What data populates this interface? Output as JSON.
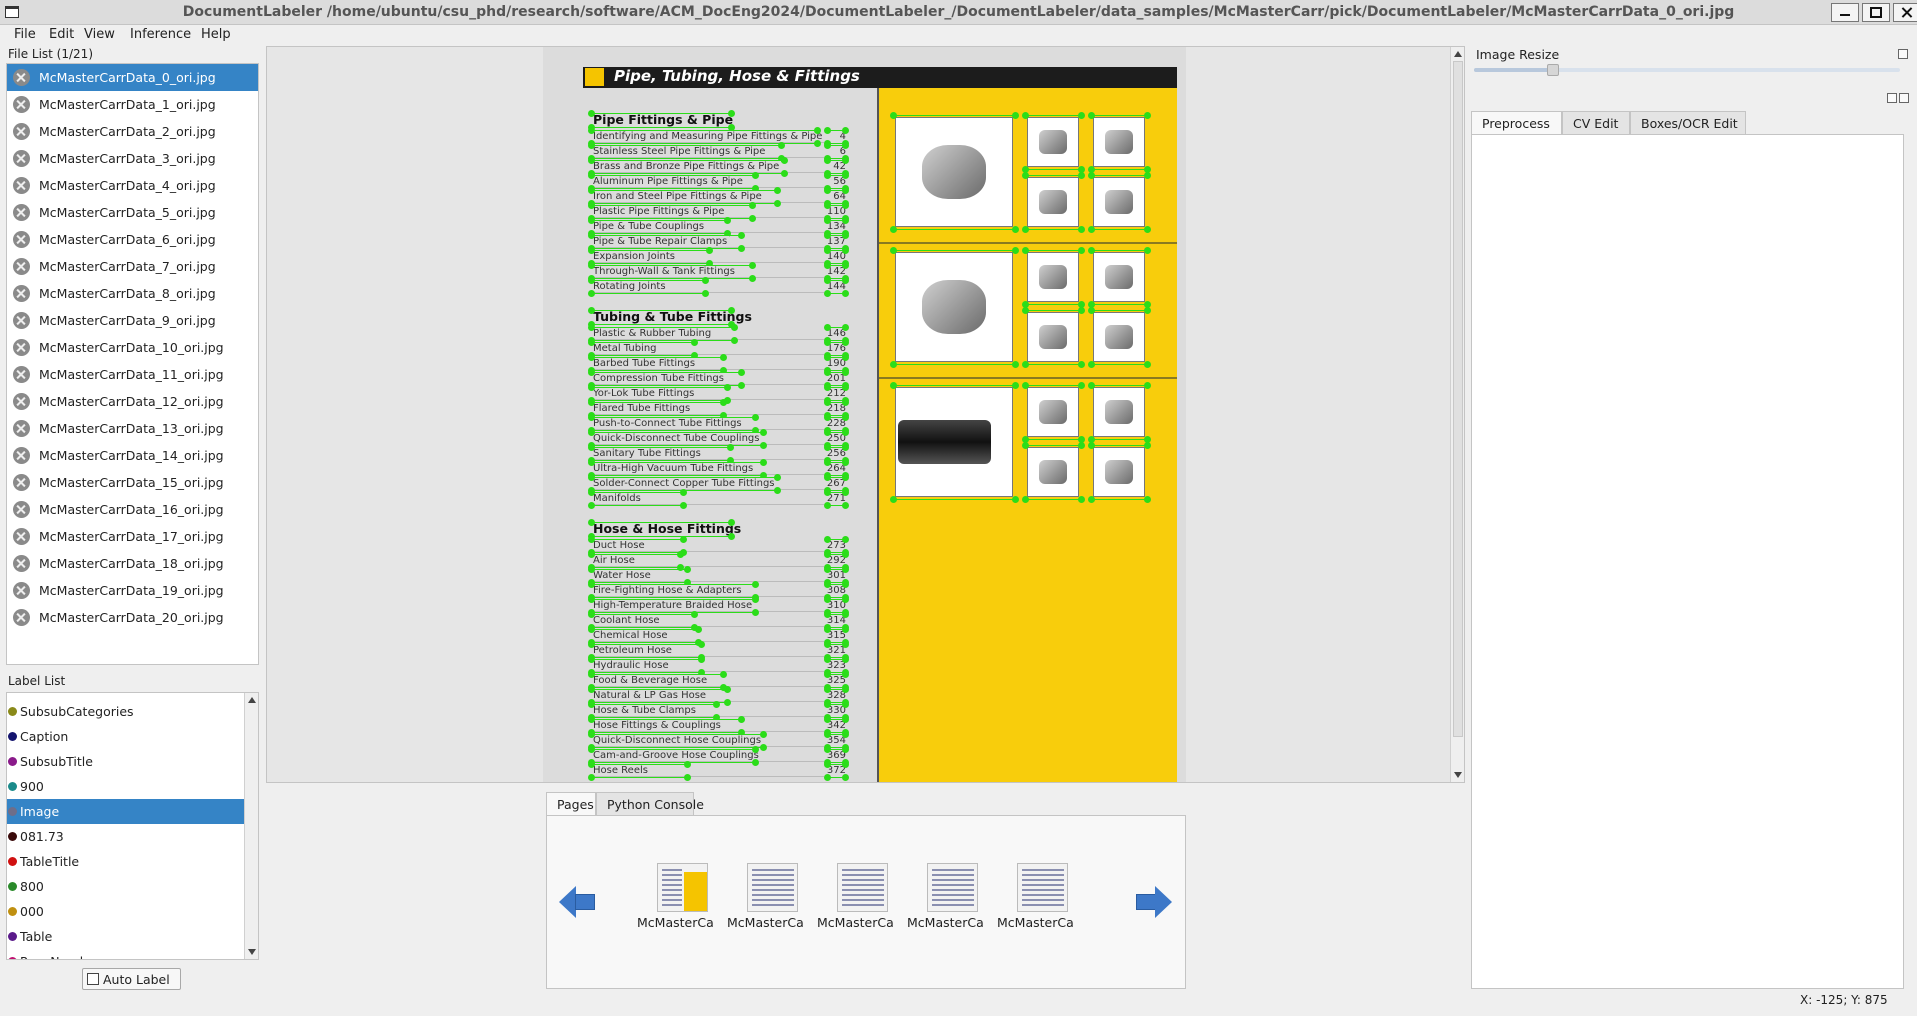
{
  "window": {
    "title": "DocumentLabeler /home/ubuntu/csu_phd/research/software/ACM_DocEng2024/DocumentLabeler_/DocumentLabeler/data_samples/McMasterCarr/pick/DocumentLabeler/McMasterCarrData_0_ori.jpg"
  },
  "menu": [
    "File",
    "Edit",
    "View",
    "Inference",
    "Help"
  ],
  "file_list": {
    "title": "File List (1/21)",
    "selected_index": 0,
    "files": [
      "McMasterCarrData_0_ori.jpg",
      "McMasterCarrData_1_ori.jpg",
      "McMasterCarrData_2_ori.jpg",
      "McMasterCarrData_3_ori.jpg",
      "McMasterCarrData_4_ori.jpg",
      "McMasterCarrData_5_ori.jpg",
      "McMasterCarrData_6_ori.jpg",
      "McMasterCarrData_7_ori.jpg",
      "McMasterCarrData_8_ori.jpg",
      "McMasterCarrData_9_ori.jpg",
      "McMasterCarrData_10_ori.jpg",
      "McMasterCarrData_11_ori.jpg",
      "McMasterCarrData_12_ori.jpg",
      "McMasterCarrData_13_ori.jpg",
      "McMasterCarrData_14_ori.jpg",
      "McMasterCarrData_15_ori.jpg",
      "McMasterCarrData_16_ori.jpg",
      "McMasterCarrData_17_ori.jpg",
      "McMasterCarrData_18_ori.jpg",
      "McMasterCarrData_19_ori.jpg",
      "McMasterCarrData_20_ori.jpg"
    ]
  },
  "label_list": {
    "title": "Label List",
    "selected_index": 4,
    "labels": [
      {
        "name": "SubsubCategories",
        "color": "#8a8a1a"
      },
      {
        "name": "Caption",
        "color": "#14146e"
      },
      {
        "name": "SubsubTitle",
        "color": "#8a1a8a"
      },
      {
        "name": "900",
        "color": "#1a8a8a"
      },
      {
        "name": "Image",
        "color": "#6e6e8a"
      },
      {
        "name": "081.73",
        "color": "#3a0a0a"
      },
      {
        "name": "TableTitle",
        "color": "#d01010"
      },
      {
        "name": "800",
        "color": "#2a8a2a"
      },
      {
        "name": "000",
        "color": "#c09010"
      },
      {
        "name": "Table",
        "color": "#5a1a8a"
      },
      {
        "name": "PageNumber",
        "color": "#c01070"
      }
    ]
  },
  "auto_label_button": "Auto Label",
  "document": {
    "header": "Pipe, Tubing, Hose & Fittings",
    "sections": [
      {
        "title": "Pipe Fittings & Pipe",
        "rows": [
          {
            "t": "Identifying and Measuring Pipe Fittings & Pipe",
            "p": "4"
          },
          {
            "t": "Stainless Steel Pipe Fittings & Pipe",
            "p": "6"
          },
          {
            "t": "Brass and Bronze Pipe Fittings & Pipe",
            "p": "42"
          },
          {
            "t": "Aluminum Pipe Fittings & Pipe",
            "p": "56"
          },
          {
            "t": "Iron and Steel Pipe Fittings & Pipe",
            "p": "64"
          },
          {
            "t": "Plastic Pipe Fittings & Pipe",
            "p": "110"
          },
          {
            "t": "Pipe & Tube Couplings",
            "p": "134"
          },
          {
            "t": "Pipe & Tube Repair Clamps",
            "p": "137"
          },
          {
            "t": "Expansion Joints",
            "p": "140"
          },
          {
            "t": "Through-Wall & Tank Fittings",
            "p": "142"
          },
          {
            "t": "Rotating Joints",
            "p": "144"
          }
        ]
      },
      {
        "title": "Tubing & Tube Fittings",
        "rows": [
          {
            "t": "Plastic & Rubber Tubing",
            "p": "146"
          },
          {
            "t": "Metal Tubing",
            "p": "176"
          },
          {
            "t": "Barbed Tube Fittings",
            "p": "190"
          },
          {
            "t": "Compression Tube Fittings",
            "p": "201"
          },
          {
            "t": "Yor-Lok Tube Fittings",
            "p": "212"
          },
          {
            "t": "Flared Tube Fittings",
            "p": "218"
          },
          {
            "t": "Push-to-Connect Tube Fittings",
            "p": "228"
          },
          {
            "t": "Quick-Disconnect Tube Couplings",
            "p": "250"
          },
          {
            "t": "Sanitary Tube Fittings",
            "p": "256"
          },
          {
            "t": "Ultra-High Vacuum Tube Fittings",
            "p": "264"
          },
          {
            "t": "Solder-Connect Copper Tube Fittings",
            "p": "267"
          },
          {
            "t": "Manifolds",
            "p": "271"
          }
        ]
      },
      {
        "title": "Hose & Hose Fittings",
        "rows": [
          {
            "t": "Duct Hose",
            "p": "273"
          },
          {
            "t": "Air Hose",
            "p": "292"
          },
          {
            "t": "Water Hose",
            "p": "301"
          },
          {
            "t": "Fire-Fighting Hose & Adapters",
            "p": "308"
          },
          {
            "t": "High-Temperature Braided Hose",
            "p": "310"
          },
          {
            "t": "Coolant Hose",
            "p": "314"
          },
          {
            "t": "Chemical Hose",
            "p": "315"
          },
          {
            "t": "Petroleum Hose",
            "p": "321"
          },
          {
            "t": "Hydraulic Hose",
            "p": "323"
          },
          {
            "t": "Food & Beverage Hose",
            "p": "325"
          },
          {
            "t": "Natural & LP Gas Hose",
            "p": "328"
          },
          {
            "t": "Hose & Tube Clamps",
            "p": "330"
          },
          {
            "t": "Hose Fittings & Couplings",
            "p": "342"
          },
          {
            "t": "Quick-Disconnect Hose Couplings",
            "p": "354"
          },
          {
            "t": "Cam-and-Groove Hose Couplings",
            "p": "369"
          },
          {
            "t": "Hose Reels",
            "p": "372"
          }
        ]
      }
    ]
  },
  "bottom_tabs": [
    "Pages",
    "Python Console"
  ],
  "thumbnails": [
    "McMasterCa",
    "McMasterCa",
    "McMasterCa",
    "McMasterCa",
    "McMasterCa"
  ],
  "right_panel": {
    "image_resize_title": "Image Resize",
    "resize_level": 0.19,
    "tabs": [
      "Preprocess",
      "CV Edit",
      "Boxes/OCR Edit"
    ]
  },
  "status": "X: -125; Y: 875"
}
